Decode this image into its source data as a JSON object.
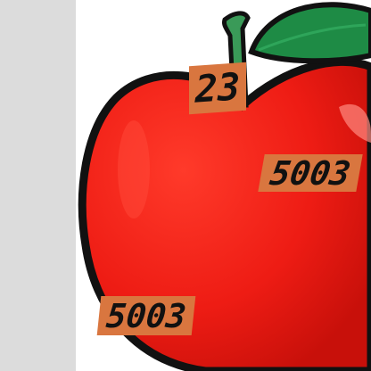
{
  "colors": {
    "apple_red": "#ee1c14",
    "apple_outline": "#111111",
    "leaf_green": "#1e8b45",
    "stem_green": "#3a9a58",
    "tag_orange": "#d9763f",
    "side_panel_gray": "#dcdcdc"
  },
  "labels": {
    "stem_tag": "23",
    "right_tag": "5003",
    "bottom_tag": "5003"
  }
}
